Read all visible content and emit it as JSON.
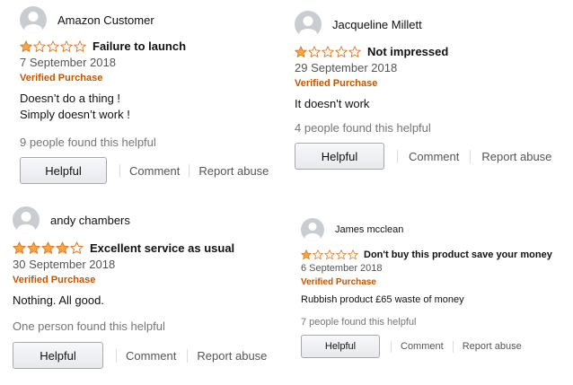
{
  "colors": {
    "star": "#f3a847",
    "star_outline": "#de7921",
    "verified": "#c45500"
  },
  "reviews": [
    {
      "user": "Amazon Customer",
      "stars": 1,
      "title": "Failure to launch",
      "date": "7 September 2018",
      "verified": "Verified Purchase",
      "body": "Doesn’t do a thing !\nSimply doesn’t work !",
      "helpful_count": "9 people found this helpful",
      "helpful_button": "Helpful",
      "comment": "Comment",
      "report": "Report abuse"
    },
    {
      "user": "Jacqueline Millett",
      "stars": 1,
      "title": "Not impressed",
      "date": "29 September 2018",
      "verified": "Verified Purchase",
      "body": "It doesn't work",
      "helpful_count": "4 people found this helpful",
      "helpful_button": "Helpful",
      "comment": "Comment",
      "report": "Report abuse"
    },
    {
      "user": "andy chambers",
      "stars": 4,
      "title": "Excellent service as usual",
      "date": "30 September 2018",
      "verified": "Verified Purchase",
      "body": "Nothing. All good.",
      "helpful_count": "One person found this helpful",
      "helpful_button": "Helpful",
      "comment": "Comment",
      "report": "Report abuse"
    },
    {
      "user": "James mcclean",
      "stars": 1,
      "title": "Don't buy this product save your money",
      "date": "6 September 2018",
      "verified": "Verified Purchase",
      "body": "Rubbish product £65 waste of money",
      "helpful_count": "7 people found this helpful",
      "helpful_button": "Helpful",
      "comment": "Comment",
      "report": "Report abuse"
    }
  ]
}
